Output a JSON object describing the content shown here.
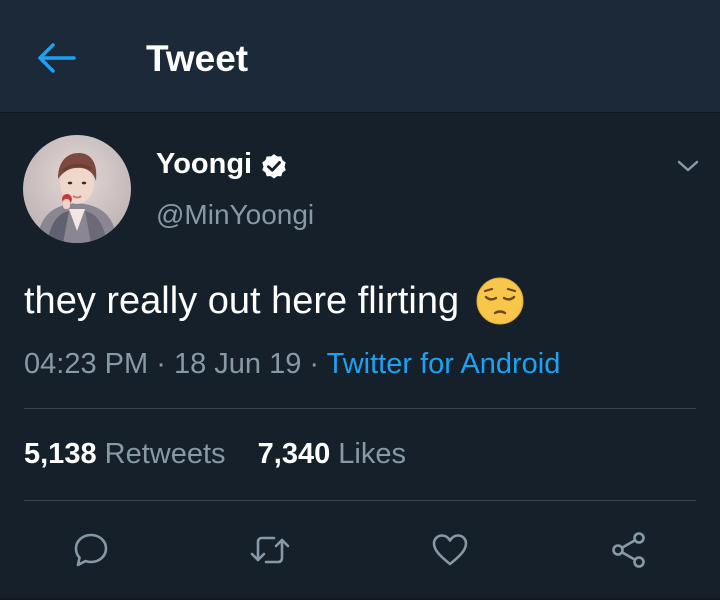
{
  "header": {
    "title": "Tweet",
    "back_icon": "arrow-left-icon",
    "accent": "#1da1f2"
  },
  "author": {
    "display_name": "Yoongi",
    "handle": "@MinYoongi",
    "verified": true
  },
  "tweet": {
    "text": "they really out here flirting",
    "emoji": "pensive-face",
    "time": "04:23 PM",
    "date": "18 Jun 19",
    "source": "Twitter for Android",
    "separator": "·"
  },
  "stats": {
    "retweets_count": "5,138",
    "retweets_label": "Retweets",
    "likes_count": "7,340",
    "likes_label": "Likes"
  },
  "actions": [
    "reply-icon",
    "retweet-icon",
    "like-icon",
    "share-icon"
  ],
  "colors": {
    "background": "#15202b",
    "header": "#1c2938",
    "muted": "#8899a6",
    "accent": "#1da1f2"
  }
}
